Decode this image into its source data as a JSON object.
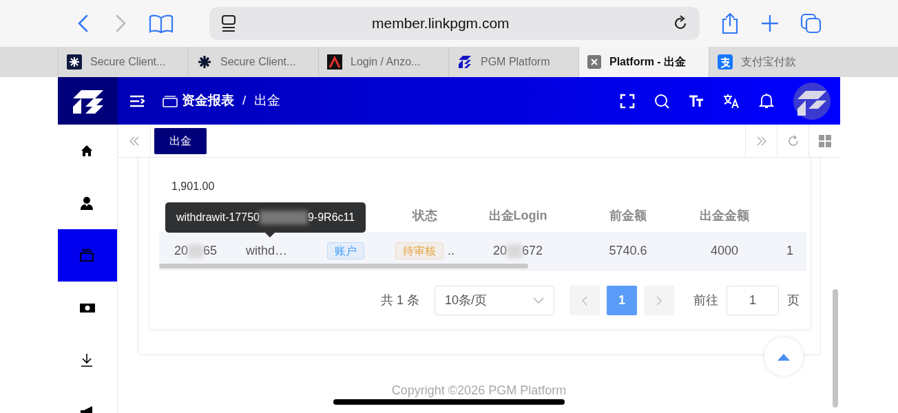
{
  "browser": {
    "url": "member.linkpgm.com",
    "tabs": [
      {
        "title": "Secure Client...",
        "kind": "sparkle-dark",
        "selected": false
      },
      {
        "title": "Secure Client...",
        "kind": "sparkle",
        "selected": false
      },
      {
        "title": "Login / Anzo...",
        "kind": "triangle",
        "selected": false
      },
      {
        "title": "PGM Platform",
        "kind": "logo",
        "selected": false
      },
      {
        "title": "Platform - 出金",
        "kind": "close",
        "selected": true
      },
      {
        "title": "支付宝付款",
        "kind": "alipay",
        "selected": false
      }
    ]
  },
  "header": {
    "breadcrumb": [
      "资金报表",
      "出金"
    ],
    "separator": "/"
  },
  "sidebar": {
    "items": [
      {
        "kind": "home",
        "selected": false
      },
      {
        "kind": "user",
        "selected": false
      },
      {
        "kind": "wallet",
        "selected": true
      },
      {
        "kind": "cash",
        "selected": false
      },
      {
        "kind": "download",
        "selected": false
      },
      {
        "kind": "megaphone",
        "selected": false
      }
    ]
  },
  "page_tabs": [
    {
      "label": "出金",
      "selected": true
    }
  ],
  "summary": {
    "value": "1,901.00"
  },
  "table": {
    "columns": [
      "",
      "",
      "",
      "状态",
      "出金Login",
      "前金额",
      "出金金额"
    ],
    "rows": [
      {
        "cells": [
          {
            "kind": "redacted",
            "prefix": "20",
            "suffix": "65"
          },
          {
            "kind": "text",
            "text": "withd…"
          },
          {
            "kind": "tag",
            "text": "账户",
            "color": "#409eff"
          },
          {
            "kind": "tag",
            "text": "待审核",
            "color": "#e6a23c",
            "overflow": ".."
          },
          {
            "kind": "redacted",
            "prefix": "20",
            "suffix": "672"
          },
          {
            "kind": "text",
            "text": "5740.6"
          },
          {
            "kind": "text",
            "text": "4000"
          },
          {
            "kind": "text",
            "text": "1"
          }
        ]
      }
    ]
  },
  "tooltip": {
    "prefix": "withdrawit-17750",
    "suffix": "9-9R6c11"
  },
  "pagination": {
    "total": "共 1 条",
    "page_size": "10条/页",
    "pages": [
      {
        "label": "1",
        "selected": true
      }
    ],
    "goto_label": "前往",
    "goto_value": "1",
    "goto_suffix": "页"
  },
  "footer": "Copyright ©2026 PGM Platform"
}
